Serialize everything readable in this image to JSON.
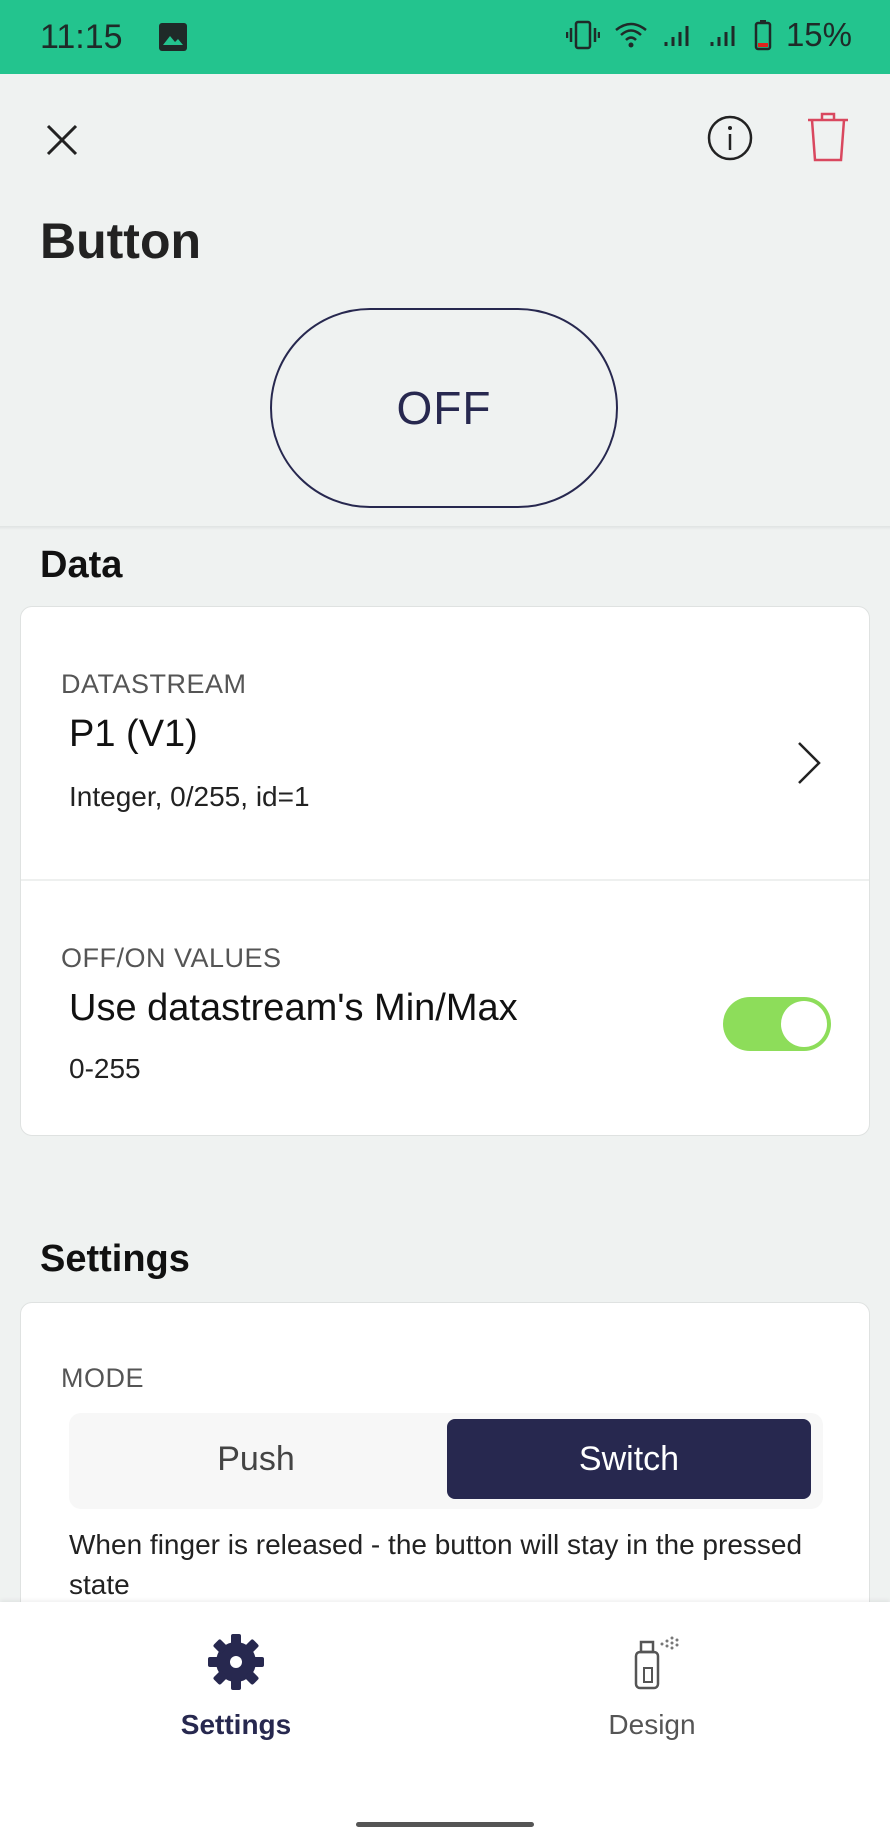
{
  "status_bar": {
    "time": "11:15",
    "battery": "15%"
  },
  "header": {
    "title": "Button"
  },
  "preview": {
    "button_label": "OFF"
  },
  "data_section": {
    "title": "Data",
    "datastream": {
      "label": "DATASTREAM",
      "value": "P1 (V1)",
      "detail": "Integer, 0/255, id=1"
    },
    "off_on_values": {
      "label": "OFF/ON VALUES",
      "value": "Use datastream's Min/Max",
      "detail": "0-255",
      "toggle_on": true
    }
  },
  "settings_section": {
    "title": "Settings",
    "mode": {
      "label": "MODE",
      "options": [
        "Push",
        "Switch"
      ],
      "selected": "Switch",
      "description": "When finger is released - the button will stay in the pressed state"
    }
  },
  "bottom_nav": {
    "settings_label": "Settings",
    "design_label": "Design",
    "active": "Settings"
  },
  "colors": {
    "status_bar": "#23c48e",
    "accent": "#27284f",
    "toggle_on": "#8ddd5a",
    "trash": "#d9485f"
  }
}
